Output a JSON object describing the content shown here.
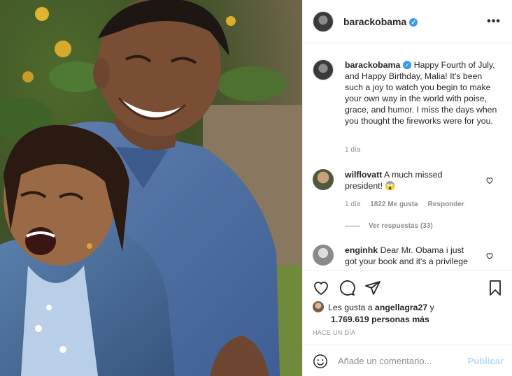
{
  "post": {
    "author": "barackobama",
    "photo_description": "Photo of a laughing man in a blue shirt with a young girl in a denim jacket, outdoors in a garden"
  },
  "header": {
    "username": "barackobama",
    "more_label": "•••"
  },
  "caption": {
    "username": "barackobama",
    "text": "Happy Fourth of July, and Happy Birthday, Malia! It's been such a joy to watch you begin to make your own way in the world with poise, grace, and humor. I miss the days when you thought the fireworks were for you.",
    "time": "1 día"
  },
  "comments": [
    {
      "username": "wilflovatt",
      "text": "A much missed president! 😱",
      "time": "1 día",
      "likes": "1822 Me gusta",
      "reply_label": "Responder",
      "view_replies": "Ver respuestas (33)"
    },
    {
      "username": "enginhk",
      "text": "Dear Mr. Obama i just got your book and it's a privilege"
    }
  ],
  "likes": {
    "prefix": "Les gusta a ",
    "user": "angellagra27",
    "connector": " y",
    "count": "1.769.619 personas más"
  },
  "timestamp": "HACE UN DÍA",
  "add_comment": {
    "placeholder": "Añade un comentario...",
    "post_label": "Publicar"
  },
  "colors": {
    "verified": "#3897f0",
    "post_disabled": "#b3dbff",
    "muted": "#8e8e8e"
  }
}
